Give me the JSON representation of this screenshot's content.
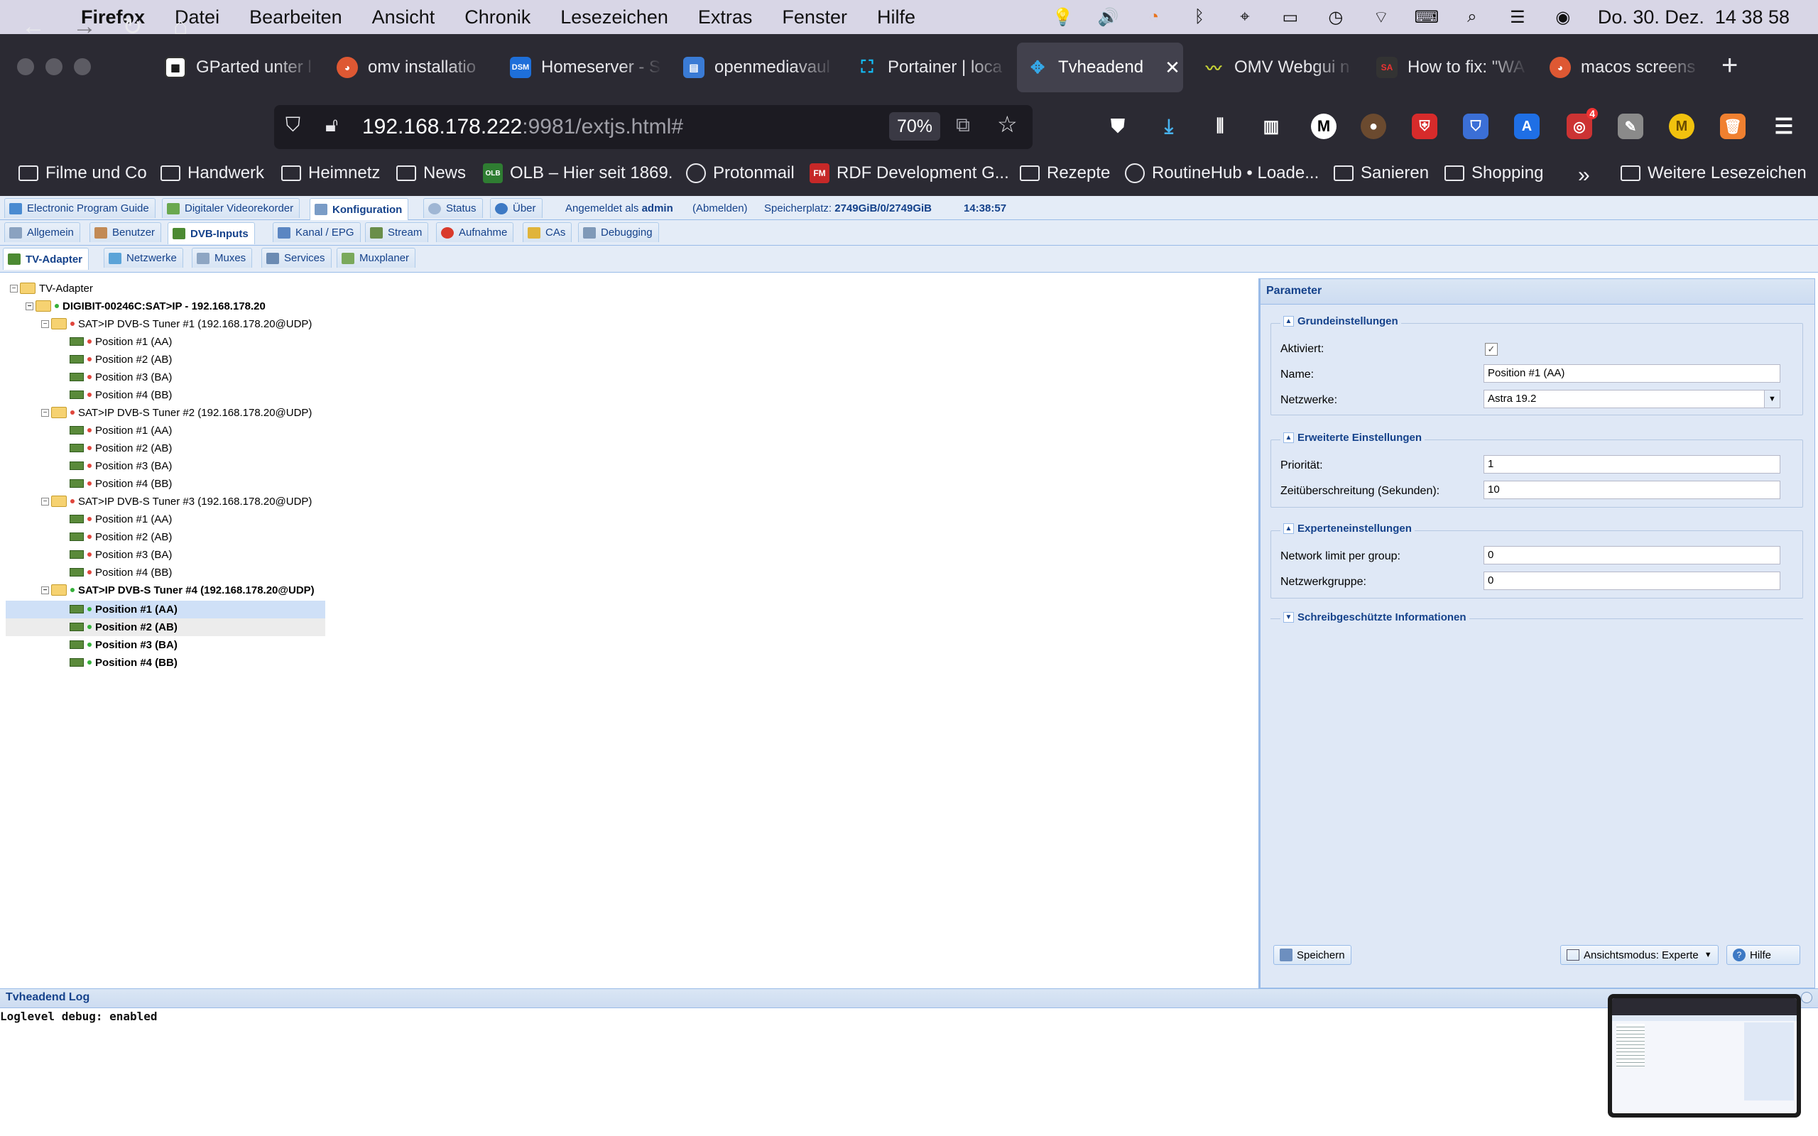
{
  "menubar": {
    "app": "Firefox",
    "items": [
      "Datei",
      "Bearbeiten",
      "Ansicht",
      "Chronik",
      "Lesezeichen",
      "Extras",
      "Fenster",
      "Hilfe"
    ],
    "clock": "Do. 30. Dez.  14 38 58",
    "status_icons": [
      "lightbulb-icon",
      "volume-icon",
      "rss-icon",
      "bluetooth-icon",
      "cursor-icon",
      "battery-icon",
      "time-machine-icon",
      "wifi-icon",
      "keyboard-icon",
      "spotlight-icon",
      "control-center-icon",
      "siri-icon"
    ]
  },
  "tabs": [
    {
      "label": "GParted unter l",
      "favicon": "gparted"
    },
    {
      "label": "omv installatio",
      "favicon": "duckduckgo"
    },
    {
      "label": "Homeserver - S",
      "favicon": "dsm",
      "favicon_text": "DSM"
    },
    {
      "label": "openmediavaul",
      "favicon": "doc"
    },
    {
      "label": "Portainer | loca",
      "favicon": "portainer"
    },
    {
      "label": "Tvheadend",
      "favicon": "tvheadend",
      "active": true
    },
    {
      "label": "OMV Webgui n",
      "favicon": "omv"
    },
    {
      "label": "How to fix: \"WA",
      "favicon": "sa",
      "favicon_text": "SA"
    },
    {
      "label": "macos screens",
      "favicon": "duckduckgo"
    }
  ],
  "navbar": {
    "url_host": "192.168.178.222",
    "url_rest": ":9981/extjs.html#",
    "zoom": "70%",
    "ext_badge": "4",
    "ext_m": "M"
  },
  "bookmarks": [
    {
      "label": "Filme und Co",
      "type": "folder"
    },
    {
      "label": "Handwerk",
      "type": "folder"
    },
    {
      "label": "Heimnetz",
      "type": "folder"
    },
    {
      "label": "News",
      "type": "folder"
    },
    {
      "label": "OLB – Hier seit 1869.",
      "type": "site",
      "icon_text": "OLB"
    },
    {
      "label": "Protonmail",
      "type": "globe"
    },
    {
      "label": "RDF Development G...",
      "type": "site",
      "icon_text": "FM"
    },
    {
      "label": "Rezepte",
      "type": "folder"
    },
    {
      "label": "RoutineHub • Loade...",
      "type": "globe"
    },
    {
      "label": "Sanieren",
      "type": "folder"
    },
    {
      "label": "Shopping",
      "type": "folder"
    },
    {
      "label": "Weitere Lesezeichen",
      "type": "folder"
    }
  ],
  "tvh": {
    "main_tabs": [
      "Electronic Program Guide",
      "Digitaler Videorekorder",
      "Konfiguration",
      "Status",
      "Über"
    ],
    "login_prefix": "Angemeldet als",
    "user": "admin",
    "logout": "(Abmelden)",
    "storage_label": "Speicherplatz:",
    "storage": "2749GiB/0/2749GiB",
    "time": "14:38:57",
    "config_tabs": [
      "Allgemein",
      "Benutzer",
      "DVB-Inputs",
      "Kanal / EPG",
      "Stream",
      "Aufnahme",
      "CAs",
      "Debugging"
    ],
    "dvb_tabs": [
      "TV-Adapter",
      "Netzwerke",
      "Muxes",
      "Services",
      "Muxplaner"
    ],
    "tree": {
      "root": "TV-Adapter",
      "device": "DIGIBIT-00246C:SAT>IP - 192.168.178.20",
      "tuners": [
        {
          "label": "SAT>IP DVB-S Tuner #1 (192.168.178.20@UDP)",
          "positions": [
            "Position #1 (AA)",
            "Position #2 (AB)",
            "Position #3 (BA)",
            "Position #4 (BB)"
          ]
        },
        {
          "label": "SAT>IP DVB-S Tuner #2 (192.168.178.20@UDP)",
          "positions": [
            "Position #1 (AA)",
            "Position #2 (AB)",
            "Position #3 (BA)",
            "Position #4 (BB)"
          ]
        },
        {
          "label": "SAT>IP DVB-S Tuner #3 (192.168.178.20@UDP)",
          "positions": [
            "Position #1 (AA)",
            "Position #2 (AB)",
            "Position #3 (BA)",
            "Position #4 (BB)"
          ]
        },
        {
          "label": "SAT>IP DVB-S Tuner #4 (192.168.178.20@UDP)",
          "positions": [
            "Position #1 (AA)",
            "Position #2 (AB)",
            "Position #3 (BA)",
            "Position #4 (BB)"
          ]
        }
      ]
    },
    "params": {
      "title": "Parameter",
      "basic": {
        "legend": "Grundeinstellungen",
        "enabled_label": "Aktiviert:",
        "name_label": "Name:",
        "name_value": "Position #1 (AA)",
        "networks_label": "Netzwerke:",
        "networks_value": "Astra 19.2"
      },
      "advanced": {
        "legend": "Erweiterte Einstellungen",
        "priority_label": "Priorität:",
        "priority_value": "1",
        "timeout_label": "Zeitüberschreitung (Sekunden):",
        "timeout_value": "10"
      },
      "expert": {
        "legend": "Experteneinstellungen",
        "limit_label": "Network limit per group:",
        "limit_value": "0",
        "group_label": "Netzwerkgruppe:",
        "group_value": "0"
      },
      "readonly": {
        "legend": "Schreibgeschützte Informationen"
      },
      "save": "Speichern",
      "view_mode": "Ansichtsmodus: Experte",
      "help": "Hilfe"
    },
    "log": {
      "title": "Tvheadend Log",
      "line": "Loglevel debug: enabled"
    }
  },
  "colors": {
    "accent": "#15428b",
    "tab_bg": "#2b2a33",
    "ext_blue": "#dfe8f6"
  }
}
